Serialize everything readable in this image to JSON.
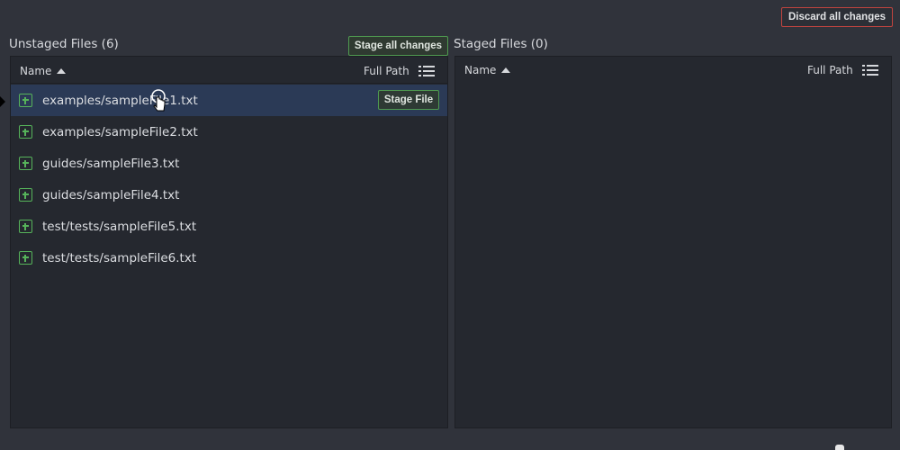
{
  "toolbar": {
    "discard_label": "Discard all changes"
  },
  "unstaged": {
    "title": "Unstaged Files (6)",
    "stage_all_label": "Stage all changes",
    "header": {
      "name": "Name",
      "path": "Full Path"
    },
    "files": [
      "examples/sampleFile1.txt",
      "examples/sampleFile2.txt",
      "guides/sampleFile3.txt",
      "guides/sampleFile4.txt",
      "test/tests/sampleFile5.txt",
      "test/tests/sampleFile6.txt"
    ],
    "stage_file_label": "Stage File"
  },
  "staged": {
    "title": "Staged Files (0)",
    "header": {
      "name": "Name",
      "path": "Full Path"
    }
  },
  "icons": {
    "file_status": "plus-square-icon",
    "sort": "sort-ascending-icon",
    "view_mode": "list-view-icon",
    "cursor": "hand-pointer-icon"
  },
  "colors": {
    "background": "#30333b",
    "panel": "#25282f",
    "selected_row": "#2b3a56",
    "success": "#56b35a",
    "danger": "#c0443f"
  }
}
